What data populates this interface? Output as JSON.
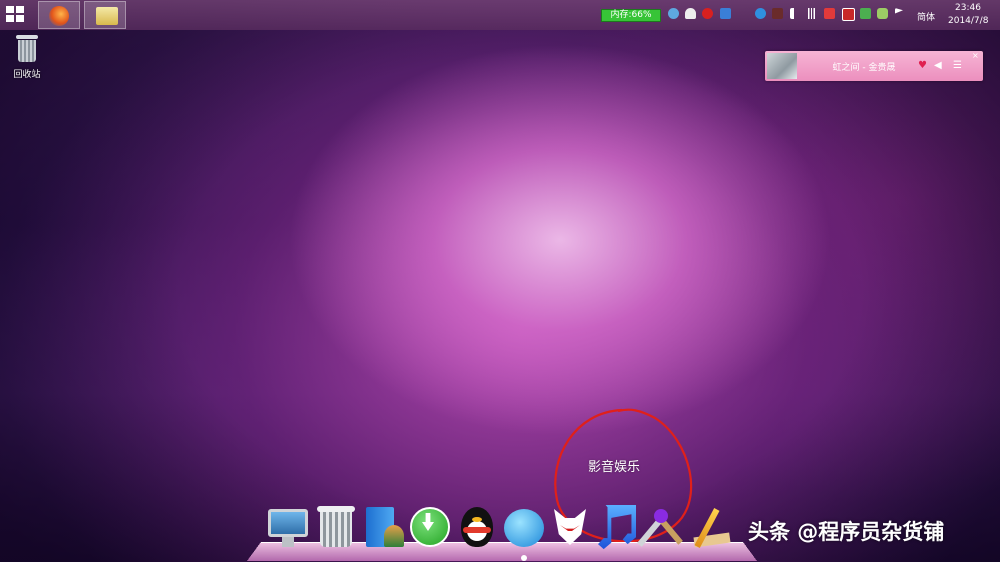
{
  "taskbar": {
    "memory_label": "内存:66%",
    "ime_label": "简体",
    "clock_time": "23:46",
    "clock_date": "2014/7/8",
    "memory_color": "#37c437"
  },
  "desktop": {
    "recycle_bin_label": "回收站",
    "entertainment_label": "影音娱乐",
    "annotation_color": "#e0201a"
  },
  "music_widget": {
    "song_title": "虹之间 - 金贵晟",
    "background": "#f2a4cb"
  },
  "dock": {
    "items": [
      "monitor-icon",
      "trash-icon",
      "folder-icon",
      "download-icon",
      "qq-icon",
      "browser-icon",
      "fox-icon",
      "music-note-icon",
      "tools-icon",
      "pencil-ruler-icon"
    ]
  },
  "watermark": "头条 @程序员杂货铺"
}
